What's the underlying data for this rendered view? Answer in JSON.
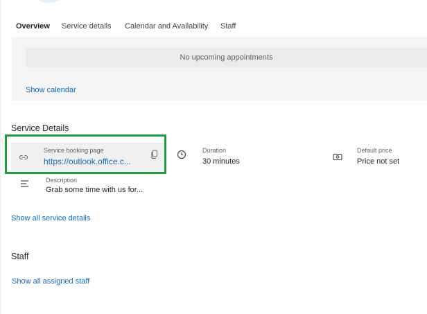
{
  "tabs": [
    {
      "label": "Overview",
      "active": true
    },
    {
      "label": "Service details",
      "active": false
    },
    {
      "label": "Calendar and Availability",
      "active": false
    },
    {
      "label": "Staff",
      "active": false
    }
  ],
  "calendar": {
    "empty_message": "No upcoming appointments",
    "show_calendar_link": "Show calendar"
  },
  "service_details": {
    "title": "Service Details",
    "booking_page": {
      "label": "Service booking page",
      "url": "https://outlook.office.c..."
    },
    "duration": {
      "label": "Duration",
      "value": "30 minutes"
    },
    "default_price": {
      "label": "Default price",
      "value": "Price not set"
    },
    "description": {
      "label": "Description",
      "value": "Grab some time with us for..."
    },
    "show_all_link": "Show all service details"
  },
  "staff": {
    "title": "Staff",
    "show_all_link": "Show all assigned staff"
  },
  "colors": {
    "accent": "#0f6cbd",
    "highlight": "#1e9e3a"
  }
}
